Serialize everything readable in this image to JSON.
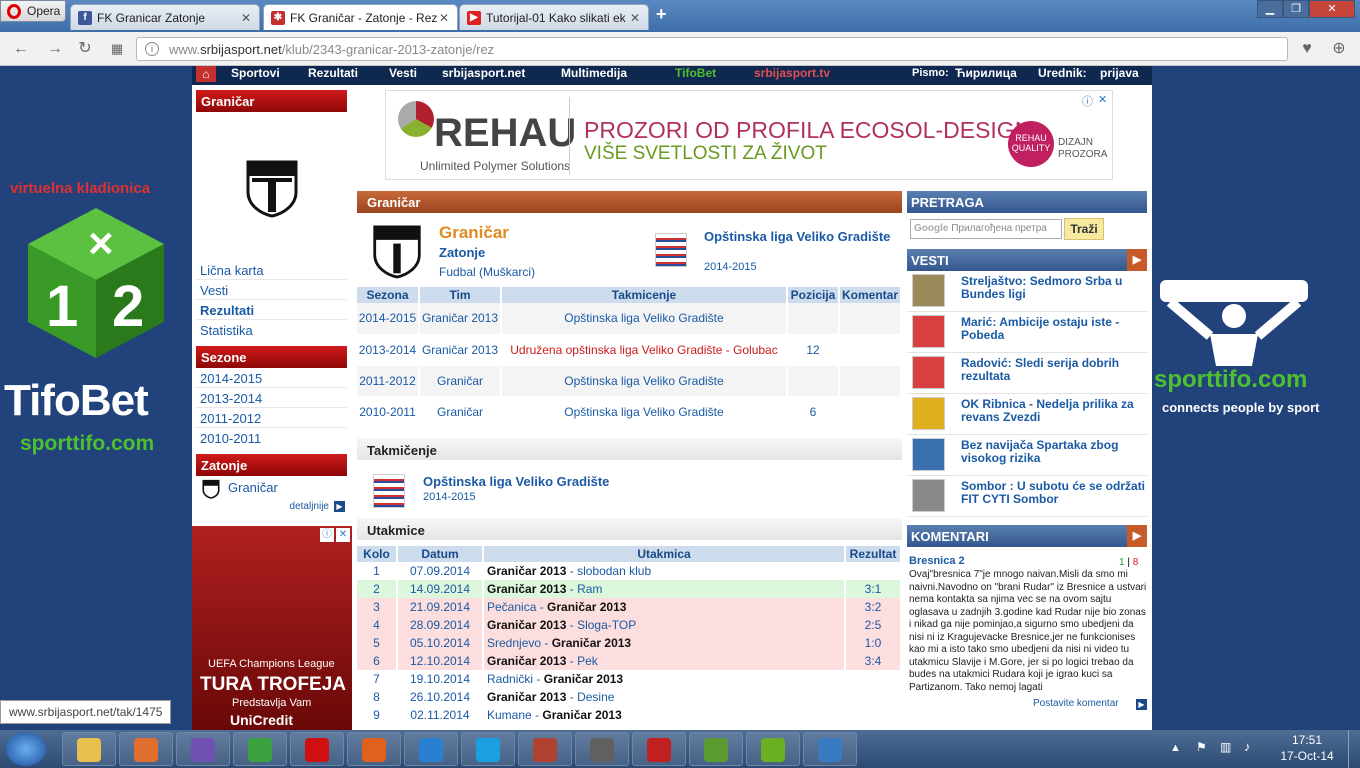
{
  "browser": {
    "opera_label": "Opera",
    "tabs": [
      {
        "title": "FK Granicar Zatonje",
        "icon": "facebook-icon",
        "color": "#3b5998",
        "glyph": "f"
      },
      {
        "title": "FK Graničar - Zatonje - Rez",
        "icon": "site-icon",
        "color": "#c43030",
        "glyph": "✱"
      },
      {
        "title": "Tutorijal-01 Kako slikati ek",
        "icon": "youtube-icon",
        "color": "#e02020",
        "glyph": "▶"
      }
    ],
    "url_prefix": "www.",
    "url_domain": "srbijasport.net",
    "url_path": "/klub/2343-granicar-2013-zatonje/rez"
  },
  "site_nav": {
    "items": [
      "Sportovi",
      "Rezultati",
      "Vesti",
      "srbijasport.net",
      "Multimedija",
      "TifoBet",
      "srbijasport.tv"
    ],
    "script_label": "Pismo:",
    "script_value": "Ћирилица",
    "editor_label": "Urednik:",
    "editor_value": "prijava"
  },
  "left_ads": {
    "title": "virtuelna kladionica",
    "brand": "TifoBet",
    "site": "sporttifo.com",
    "right_site": "sporttifo.com",
    "right_slogan": "connects people by sport"
  },
  "sidebar": {
    "club_header": "Graničar",
    "links": [
      {
        "label": "Lična karta"
      },
      {
        "label": "Vesti"
      },
      {
        "label": "Rezultati"
      },
      {
        "label": "Statistika"
      }
    ],
    "seasons_header": "Sezone",
    "seasons": [
      "2014-2015",
      "2013-2014",
      "2011-2012",
      "2010-2011"
    ],
    "town_header": "Zatonje",
    "town_club": "Graničar",
    "details": "detaljnije",
    "ad": {
      "league": "UEFA Champions League",
      "title": "TURA TROFEJA",
      "sub": "Predstavlja Vam",
      "sponsor": "UniCredit"
    }
  },
  "banner": {
    "brand": "REHAU",
    "tagline": "Unlimited Polymer Solutions",
    "line1": "PROZORI OD PROFILA ECOSOL-DESIGN",
    "line2": "VIŠE SVETLOSTI ZA ŽIVOT",
    "badge1": "REHAU",
    "badge2": "QUALITY",
    "side1": "DIZAJN",
    "side2": "PROZORA"
  },
  "club": {
    "header": "Graničar",
    "name": "Graničar",
    "town": "Zatonje",
    "sport": "Fudbal",
    "category": "Muškarci",
    "league": "Opštinska liga Veliko Gradište",
    "season": "2014-2015",
    "table_headers": [
      "Sezona",
      "Tim",
      "Takmicenje",
      "Pozicija",
      "Komentar"
    ],
    "rows": [
      {
        "season": "2014-2015",
        "team": "Graničar 2013",
        "comp": "Opštinska liga Veliko Gradište",
        "pos": "",
        "comment": ""
      },
      {
        "season": "2013-2014",
        "team": "Graničar 2013",
        "comp": "Udružena opštinska liga Veliko Gradište - Golubac",
        "pos": "12",
        "comment": ""
      },
      {
        "season": "2011-2012",
        "team": "Graničar",
        "comp": "Opštinska liga Veliko Gradište",
        "pos": "",
        "comment": ""
      },
      {
        "season": "2010-2011",
        "team": "Graničar",
        "comp": "Opštinska liga Veliko Gradište",
        "pos": "6",
        "comment": ""
      }
    ]
  },
  "competition": {
    "header": "Takmičenje",
    "name": "Opštinska liga Veliko Gradište",
    "season": "2014-2015"
  },
  "matches": {
    "header": "Utakmice",
    "headers": [
      "Kolo",
      "Datum",
      "Utakmica",
      "Rezultat"
    ],
    "rows": [
      {
        "round": "1",
        "date": "07.09.2014",
        "home": "Graničar 2013",
        "away": "slobodan klub",
        "home_bold": true,
        "result": "",
        "bg": "w"
      },
      {
        "round": "2",
        "date": "14.09.2014",
        "home": "Graničar 2013",
        "away": "Ram",
        "home_bold": true,
        "result": "3:1",
        "bg": "g"
      },
      {
        "round": "3",
        "date": "21.09.2014",
        "home": "Pečanica",
        "away": "Graničar 2013",
        "home_bold": false,
        "result": "3:2",
        "bg": "p"
      },
      {
        "round": "4",
        "date": "28.09.2014",
        "home": "Graničar 2013",
        "away": "Sloga-TOP",
        "home_bold": true,
        "result": "2:5",
        "bg": "p"
      },
      {
        "round": "5",
        "date": "05.10.2014",
        "home": "Srednjevo",
        "away": "Graničar 2013",
        "home_bold": false,
        "result": "1:0",
        "bg": "p"
      },
      {
        "round": "6",
        "date": "12.10.2014",
        "home": "Graničar 2013",
        "away": "Pek",
        "home_bold": true,
        "result": "3:4",
        "bg": "p"
      },
      {
        "round": "7",
        "date": "19.10.2014",
        "home": "Radnički",
        "away": "Graničar 2013",
        "home_bold": false,
        "result": "",
        "bg": "w"
      },
      {
        "round": "8",
        "date": "26.10.2014",
        "home": "Graničar 2013",
        "away": "Desine",
        "home_bold": true,
        "result": "",
        "bg": "w"
      },
      {
        "round": "9",
        "date": "02.11.2014",
        "home": "Kumane",
        "away": "Graničar 2013",
        "home_bold": false,
        "result": "",
        "bg": "w"
      }
    ]
  },
  "search": {
    "header": "PRETRAGA",
    "placeholder": "Прилагођена претра",
    "button": "Traži",
    "google": "Google"
  },
  "news": {
    "header": "VESTI",
    "items": [
      {
        "title": "Streljaštvo: Sedmoro Srba u Bundes ligi",
        "color": "#9a8a5a"
      },
      {
        "title": "Marić: Ambicije ostaju iste - Pobeda",
        "color": "#d94040"
      },
      {
        "title": "Radović: Sledi serija dobrih rezultata",
        "color": "#d94040"
      },
      {
        "title": "OK Ribnica - Nedelja prilika za revans Zvezdi",
        "color": "#e0b020"
      },
      {
        "title": "Bez navijača Spartaka zbog visokog rizika",
        "color": "#3a6fb0"
      },
      {
        "title": "Sombor : U subotu će se održati FIT CYTI Sombor",
        "color": "#8a8a8a"
      }
    ]
  },
  "comments": {
    "header": "KOMENTARI",
    "club": "Bresnica 2",
    "votes_up": "1",
    "votes_down": "8",
    "text": "Ovaj\"bresnica 7\"je mnogo naivan.Misli da smo mi naivni.Navodno on \"brani Rudar\" iz Bresnice a ustvari nema kontakta sa njima vec se na ovom sajtu oglasava u zadnjih 3.godine kad Rudar nije bio zonas i nikad ga nije pominjao,a sigurno smo ubedjeni da nisi ni iz Kragujevacke Bresnice,jer ne funkcionises kao mi a isto tako smo ubedjeni da nisi ni video tu utakmicu Slavije i M.Gore, jer si po logici trebao da budes na utakmici Rudara koji je igrao kuci sa Partizanom. Tako nemoj lagati",
    "post_link": "Postavite komentar"
  },
  "status_url": "www.srbijasport.net/tak/1475",
  "taskbar": {
    "time": "17:51",
    "date": "17-Oct-14",
    "apps": [
      {
        "name": "explorer-icon",
        "color": "#e8c050"
      },
      {
        "name": "media-player-icon",
        "color": "#e07030"
      },
      {
        "name": "visual-studio-icon",
        "color": "#7050b0"
      },
      {
        "name": "chrome-icon",
        "color": "#3aa040"
      },
      {
        "name": "opera-icon",
        "color": "#d01010"
      },
      {
        "name": "firefox-icon",
        "color": "#e06020"
      },
      {
        "name": "ie-icon",
        "color": "#2a80d0"
      },
      {
        "name": "skype-icon",
        "color": "#1aa0e0"
      },
      {
        "name": "game-icon",
        "color": "#b04030"
      },
      {
        "name": "truck-game-icon",
        "color": "#606060"
      },
      {
        "name": "game-red-icon",
        "color": "#c02020"
      },
      {
        "name": "minecraft-icon",
        "color": "#5a9a30"
      },
      {
        "name": "utorrent-icon",
        "color": "#6ab020"
      },
      {
        "name": "paint-icon",
        "color": "#3a7ac0"
      }
    ]
  }
}
